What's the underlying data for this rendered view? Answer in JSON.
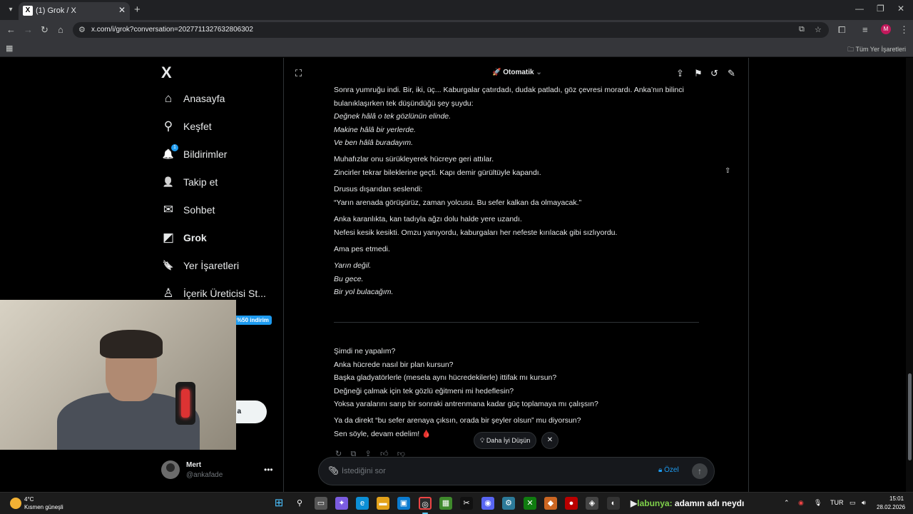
{
  "browser": {
    "tab_title": "(1) Grok / X",
    "tab_favicon": "X",
    "url": "x.com/i/grok?conversation=2027711327632806302",
    "all_bookmarks": "Tüm Yer İşaretleri",
    "profile_initial": "M"
  },
  "sidebar": {
    "logo": "X",
    "items": [
      {
        "label": "Anasayfa",
        "icon": "home-icon",
        "glyph": "⌂"
      },
      {
        "label": "Keşfet",
        "icon": "search-icon",
        "glyph": "⚲"
      },
      {
        "label": "Bildirimler",
        "icon": "bell-icon",
        "glyph": "🔔",
        "badge": "1"
      },
      {
        "label": "Takip et",
        "icon": "follow-icon",
        "glyph": "👤"
      },
      {
        "label": "Sohbet",
        "icon": "mail-icon",
        "glyph": "✉"
      },
      {
        "label": "Grok",
        "icon": "grok-icon",
        "glyph": "◩"
      },
      {
        "label": "Yer İşaretleri",
        "icon": "bookmark-icon",
        "glyph": "🔖"
      },
      {
        "label": "İçerik Üreticisi St...",
        "icon": "creator-icon",
        "glyph": "♙"
      }
    ],
    "promo_badge": "%50 indirim",
    "post_button": "a",
    "user": {
      "name": "Mert",
      "handle": "@ankafade"
    }
  },
  "grok": {
    "mode": "Otomatik",
    "paragraphs": [
      {
        "lines": [
          {
            "text": "Sonra yumruğu indi. Bir, iki, üç... Kaburgalar çatırdadı, dudak patladı, göz çevresi morardı. Anka’nın bilinci",
            "italic": false
          },
          {
            "text": "bulanıklaşırken tek düşündüğü şey şuydu:",
            "italic": false
          },
          {
            "text": "Değnek hâlâ o tek gözlünün elinde.",
            "italic": true
          },
          {
            "text": "Makine hâlâ bir yerlerde.",
            "italic": true
          },
          {
            "text": "Ve ben hâlâ buradayım.",
            "italic": true
          }
        ]
      },
      {
        "lines": [
          {
            "text": "Muhafızlar onu sürükleyerek hücreye geri attılar.",
            "italic": false
          },
          {
            "text": "Zincirler tekrar bileklerine geçti. Kapı demir gürültüyle kapandı.",
            "italic": false
          }
        ]
      },
      {
        "lines": [
          {
            "text": "Drusus dışarıdan seslendi:",
            "italic": false
          },
          {
            "text": "“Yarın arenada görüşürüz, zaman yolcusu. Bu sefer kalkan da olmayacak.”",
            "italic": false
          }
        ]
      },
      {
        "lines": [
          {
            "text": "Anka karanlıkta, kan tadıyla ağzı dolu halde yere uzandı.",
            "italic": false
          },
          {
            "text": "Nefesi kesik kesikti. Omzu yanıyordu, kaburgaları her nefeste kırılacak gibi sızlıyordu.",
            "italic": false
          }
        ]
      },
      {
        "lines": [
          {
            "text": "Ama pes etmedi.",
            "italic": false
          }
        ]
      },
      {
        "lines": [
          {
            "text": "Yarın değil.",
            "italic": true
          },
          {
            "text": "Bu gece.",
            "italic": true
          },
          {
            "text": "Bir yol bulacağım.",
            "italic": true
          }
        ]
      }
    ],
    "questions": [
      "Şimdi ne yapalım?",
      "Anka hücrede nasıl bir plan kursun?",
      "Başka gladyatörlerle (mesela aynı hücredekilerle) ittifak mı kursun?",
      "Değneği çalmak için tek gözlü eğitmeni mi hedeflesin?",
      "Yoksa yaralarını sarıp bir sonraki antrenmana kadar güç toplamaya mı çalışsın?"
    ],
    "closing": [
      "Ya da direkt “bu sefer arenaya çıksın, orada bir şeyler olsun” mu diyorsun?",
      "Sen söyle, devam edelim!"
    ],
    "closing_emoji": "🩸",
    "think_button": "Daha İyi Düşün",
    "composer_placeholder": "İstediğini sor",
    "private_label": "Özel"
  },
  "taskbar": {
    "temperature": "4°C",
    "weather": "Kısmen güneşli",
    "ticker_a": "labunya:",
    "ticker_b": "adamın adı neydı",
    "language": "TUR",
    "time": "15:01",
    "date": "28.02.2026"
  }
}
